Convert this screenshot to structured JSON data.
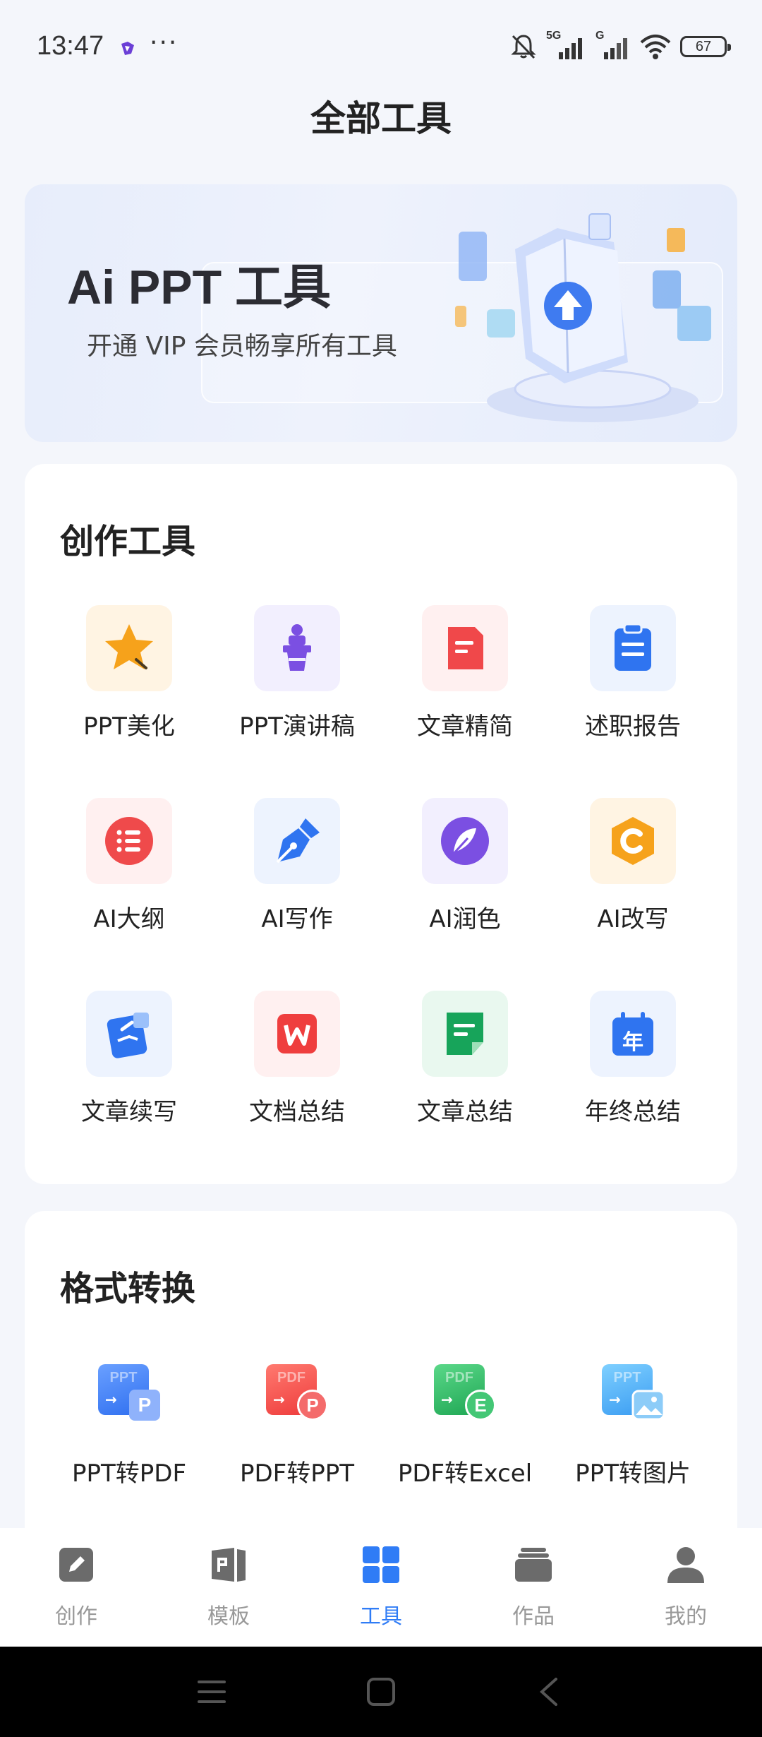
{
  "status": {
    "time": "13:47",
    "dots": "···",
    "battery": "67",
    "network": "5G",
    "network2": "G"
  },
  "page_title": "全部工具",
  "banner": {
    "title": "Ai PPT 工具",
    "subtitle": "开通 VIP 会员畅享所有工具"
  },
  "creation": {
    "title": "创作工具",
    "tools": [
      {
        "label": "PPT美化",
        "icon": "star-icon"
      },
      {
        "label": "PPT演讲稿",
        "icon": "speaker-podium-icon"
      },
      {
        "label": "文章精简",
        "icon": "document-icon"
      },
      {
        "label": "述职报告",
        "icon": "clipboard-icon"
      },
      {
        "label": "AI大纲",
        "icon": "list-icon"
      },
      {
        "label": "AI写作",
        "icon": "pen-nib-icon"
      },
      {
        "label": "AI润色",
        "icon": "feather-icon"
      },
      {
        "label": "AI改写",
        "icon": "c-hexagon-icon"
      },
      {
        "label": "文章续写",
        "icon": "write-note-icon"
      },
      {
        "label": "文档总结",
        "icon": "wps-icon"
      },
      {
        "label": "文章总结",
        "icon": "doc-summary-icon"
      },
      {
        "label": "年终总结",
        "icon": "calendar-year-icon"
      }
    ],
    "calendar_char": "年"
  },
  "conversion": {
    "title": "格式转换",
    "tools": [
      {
        "label": "PPT转PDF",
        "icon": "ppt-to-pdf-icon",
        "from": "PPT",
        "to": "P"
      },
      {
        "label": "PDF转PPT",
        "icon": "pdf-to-ppt-icon",
        "from": "PDF",
        "to": "P"
      },
      {
        "label": "PDF转Excel",
        "icon": "pdf-to-excel-icon",
        "from": "PDF",
        "to": "E"
      },
      {
        "label": "PPT转图片",
        "icon": "ppt-to-image-icon",
        "from": "PPT",
        "to": ""
      }
    ]
  },
  "nav": [
    {
      "label": "创作",
      "icon": "edit-icon"
    },
    {
      "label": "模板",
      "icon": "template-icon"
    },
    {
      "label": "工具",
      "icon": "grid-icon",
      "active": true
    },
    {
      "label": "作品",
      "icon": "stack-icon"
    },
    {
      "label": "我的",
      "icon": "user-icon"
    }
  ],
  "colors": {
    "accent": "#2f7cf6",
    "inactive": "#999999"
  }
}
